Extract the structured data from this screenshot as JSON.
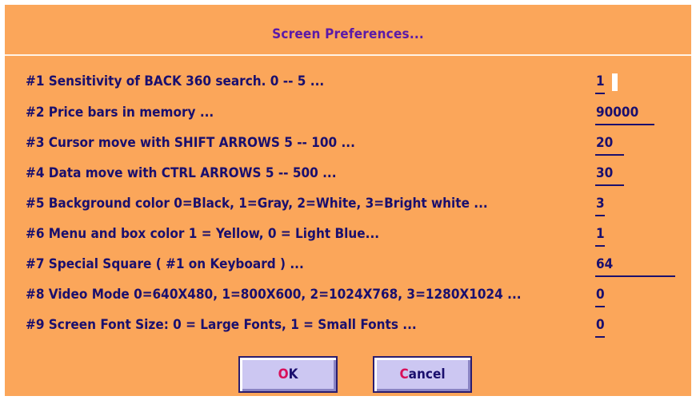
{
  "title": "Screen Preferences...",
  "rows": [
    {
      "label": "#1 Sensitivity of BACK 360 search. 0 -- 5 ...",
      "value": "1"
    },
    {
      "label": "#2 Price bars in memory ...",
      "value": "90000"
    },
    {
      "label": "#3 Cursor move with SHIFT ARROWS 5 -- 100 ...",
      "value": "20"
    },
    {
      "label": "#4 Data move with CTRL ARROWS 5 -- 500 ...",
      "value": "30"
    },
    {
      "label": "#5 Background color 0=Black, 1=Gray, 2=White, 3=Bright white ...",
      "value": "3"
    },
    {
      "label": "#6 Menu and box color 1 = Yellow, 0 = Light Blue...",
      "value": "1"
    },
    {
      "label": "#7 Special Square ( #1 on Keyboard ) ...",
      "value": "64"
    },
    {
      "label": "#8 Video Mode 0=640X480, 1=800X600, 2=1024X768, 3=1280X1024 ...",
      "value": "0"
    },
    {
      "label": "#9 Screen Font Size: 0 = Large Fonts, 1 = Small Fonts ...",
      "value": "0"
    }
  ],
  "buttons": {
    "ok": {
      "hotkey": "O",
      "rest": "K"
    },
    "cancel": {
      "hotkey": "C",
      "rest": "ancel"
    }
  },
  "colors": {
    "background": "#fba65a",
    "title": "#5b1aa8",
    "text": "#1a0f6e",
    "hotkey": "#d8105a",
    "button": "#ccc7f2"
  }
}
